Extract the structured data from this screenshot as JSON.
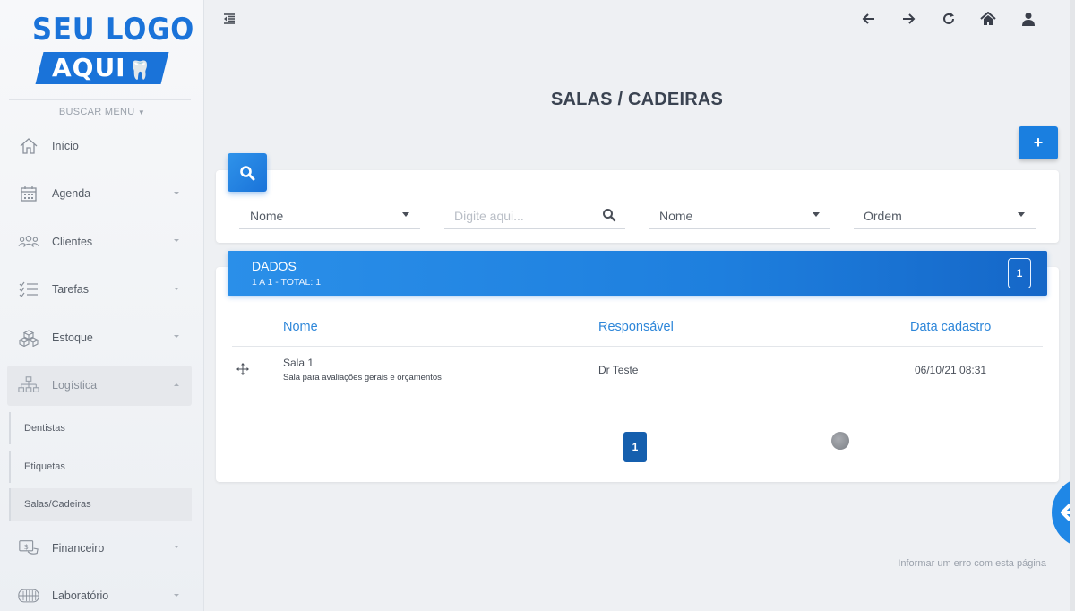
{
  "logo": {
    "line1": "SEU LOGO",
    "line2": "AQUI"
  },
  "sidebar": {
    "search_menu": "BUSCAR MENU",
    "items": [
      {
        "label": "Início",
        "icon": "home-icon"
      },
      {
        "label": "Agenda",
        "icon": "calendar-icon"
      },
      {
        "label": "Clientes",
        "icon": "users-icon"
      },
      {
        "label": "Tarefas",
        "icon": "tasks-icon"
      },
      {
        "label": "Estoque",
        "icon": "boxes-icon"
      },
      {
        "label": "Logística",
        "icon": "sitemap-icon"
      }
    ],
    "subitems": [
      {
        "label": "Dentistas"
      },
      {
        "label": "Etiquetas"
      },
      {
        "label": "Salas/Cadeiras"
      }
    ],
    "items_after": [
      {
        "label": "Financeiro",
        "icon": "money-icon"
      },
      {
        "label": "Laboratório",
        "icon": "dentures-icon"
      }
    ]
  },
  "page": {
    "title": "SALAS / CADEIRAS",
    "add_label": "+"
  },
  "filters": {
    "field1": "Nome",
    "search_placeholder": "Digite aqui...",
    "field2": "Nome",
    "field3": "Ordem"
  },
  "data_panel": {
    "title": "DADOS",
    "subtitle": "1 A 1 - TOTAL: 1",
    "page_count": "1"
  },
  "table": {
    "headers": {
      "name": "Nome",
      "responsible": "Responsável",
      "date": "Data cadastro"
    },
    "rows": [
      {
        "name": "Sala 1",
        "description": "Sala para avaliações gerais e orçamentos",
        "responsible": "Dr Teste",
        "date": "06/10/21 08:31"
      }
    ]
  },
  "pagination": {
    "current": "1"
  },
  "footer": {
    "report_link": "Informar um erro com esta página"
  },
  "colors": {
    "primary": "#1a7fe0",
    "header_text": "#2d86d9",
    "title": "#3a4351"
  }
}
